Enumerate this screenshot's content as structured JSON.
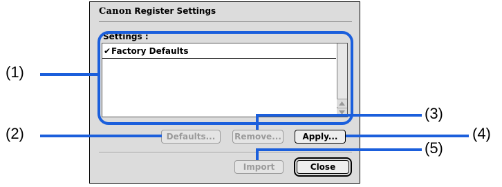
{
  "dialog": {
    "brand": "Canon",
    "title": "Register Settings"
  },
  "settings": {
    "label": "Settings :",
    "items": [
      {
        "check": "✔",
        "label": "Factory Defaults"
      }
    ]
  },
  "buttons": {
    "defaults": "Defaults...",
    "remove": "Remove...",
    "apply": "Apply...",
    "import": "Import",
    "close": "Close"
  },
  "callouts": {
    "c1": "(1)",
    "c2": "(2)",
    "c3": "(3)",
    "c4": "(4)",
    "c5": "(5)"
  },
  "colors": {
    "highlight": "#1b5fdc"
  }
}
